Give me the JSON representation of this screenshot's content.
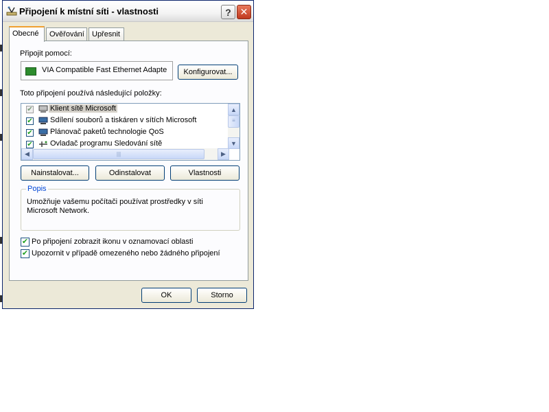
{
  "window": {
    "title": "Připojení k místní síti - vlastnosti",
    "help_button": "?",
    "close_button": "✕"
  },
  "tabs": [
    {
      "label": "Obecné",
      "active": true
    },
    {
      "label": "Ověřování",
      "active": false
    },
    {
      "label": "Upřesnit",
      "active": false
    }
  ],
  "general": {
    "connect_using_label": "Připojit pomocí:",
    "adapter_name": "VIA Compatible Fast Ethernet Adapte",
    "configure_button": "Konfigurovat...",
    "items_label": "Toto připojení používá následující položky:",
    "items": [
      {
        "label": "Klient sítě Microsoft",
        "checked": true,
        "selected": true,
        "icon": "network-client-icon"
      },
      {
        "label": "Sdílení souborů a tiskáren v sítích Microsoft",
        "checked": true,
        "selected": false,
        "icon": "network-service-icon"
      },
      {
        "label": "Plánovač paketů technologie QoS",
        "checked": true,
        "selected": false,
        "icon": "network-service-icon"
      },
      {
        "label": "Ovladač programu Sledování sítě",
        "checked": true,
        "selected": false,
        "icon": "network-protocol-icon"
      }
    ],
    "install_button": "Nainstalovat...",
    "uninstall_button": "Odinstalovat",
    "properties_button": "Vlastnosti",
    "description_title": "Popis",
    "description_text": "Umožňuje vašemu počítači používat prostředky v síti Microsoft Network.",
    "show_icon_label": "Po připojení zobrazit ikonu v oznamovací oblasti",
    "show_icon_checked": true,
    "notify_label": "Upozornit v případě omezeného nebo žádného připojení",
    "notify_checked": true
  },
  "footer": {
    "ok_button": "OK",
    "cancel_button": "Storno"
  },
  "colors": {
    "dialog_bg": "#ece9d8",
    "panel_bg": "#fcfcfe",
    "active_tab_accent": "#f0a030",
    "group_title": "#0046d5",
    "check_mark": "#21a121",
    "close_button": "#c0391f"
  }
}
